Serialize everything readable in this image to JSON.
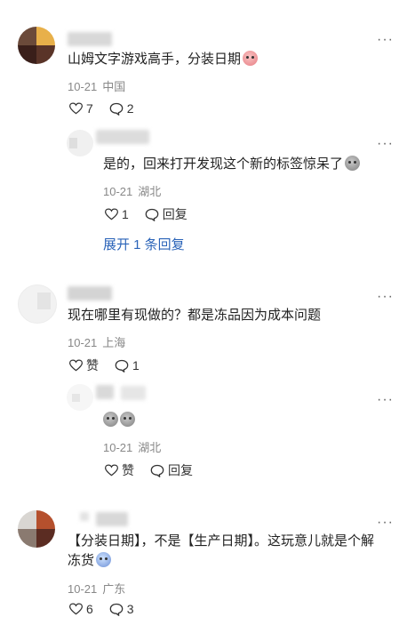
{
  "more_label": "···",
  "comments": [
    {
      "text": "山姆文字游戏高手，分装日期",
      "date": "10-21",
      "location": "中国",
      "likes": "7",
      "replies": "2",
      "reply": {
        "text": "是的，回来打开发现这个新的标签惊呆了",
        "date": "10-21",
        "location": "湖北",
        "likes": "1",
        "reply_label": "回复",
        "expand_label": "展开 1 条回复"
      }
    },
    {
      "text": "现在哪里有现做的？都是冻品因为成本问题",
      "date": "10-21",
      "location": "上海",
      "like_label": "赞",
      "replies": "1",
      "reply": {
        "text": "",
        "date": "10-21",
        "location": "湖北",
        "like_label": "赞",
        "reply_label": "回复"
      }
    },
    {
      "text_line1": "【分装日期】，不是【生产日期】。这玩意儿就是个解",
      "text_line2": "冻货",
      "date": "10-21",
      "location": "广东",
      "likes": "6",
      "replies": "3"
    }
  ]
}
